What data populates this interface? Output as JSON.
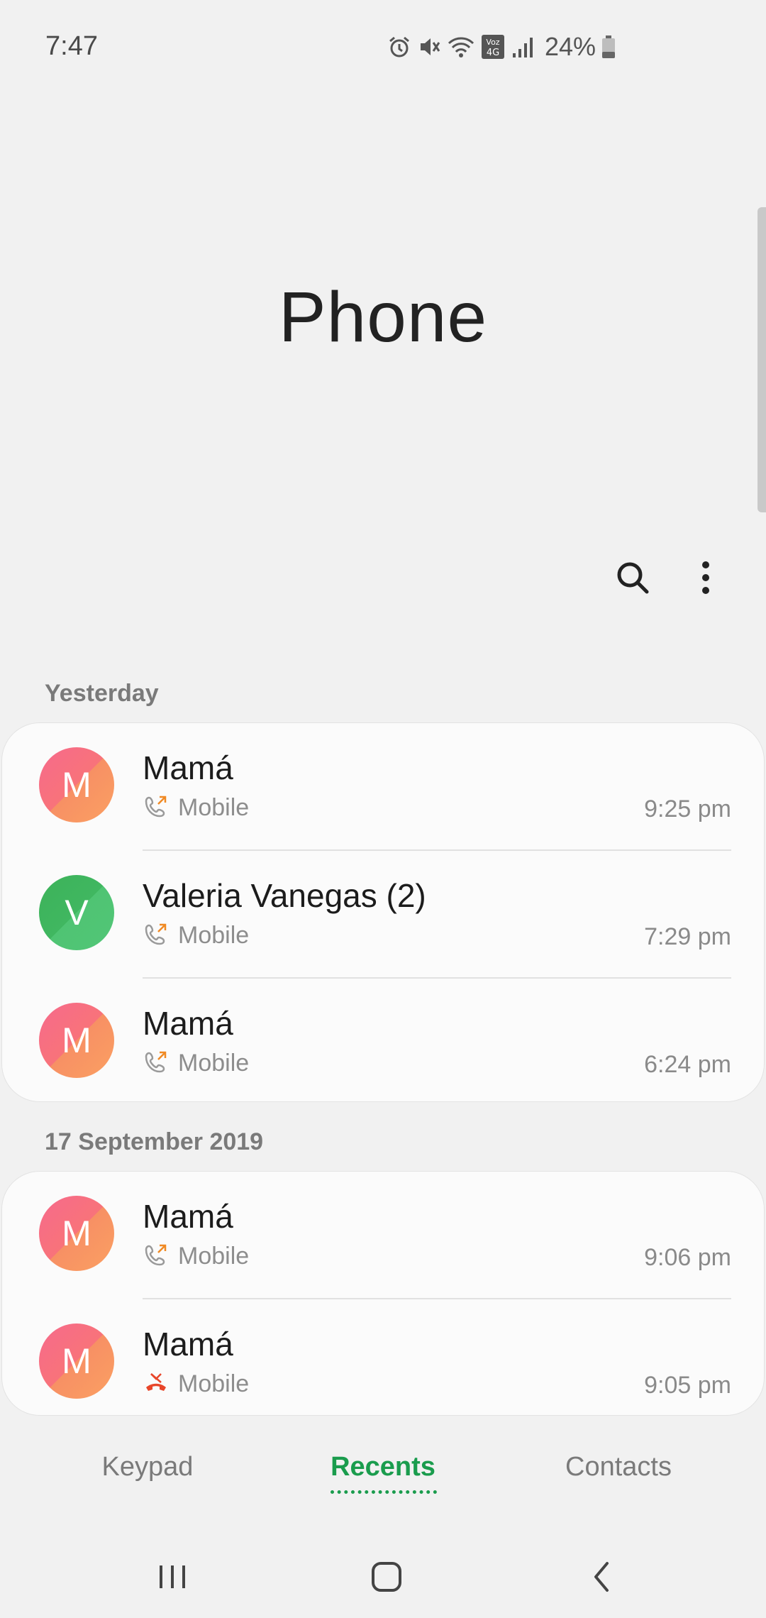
{
  "status_bar": {
    "time": "7:47",
    "battery": "24%",
    "icons": [
      "alarm-icon",
      "mute-icon",
      "wifi-icon",
      "volte-4g-icon",
      "signal-icon",
      "battery-icon"
    ]
  },
  "header": {
    "title": "Phone",
    "actions": [
      "search-icon",
      "more-options-icon"
    ]
  },
  "sections": [
    {
      "label": "Yesterday",
      "calls": [
        {
          "initial": "M",
          "name": "Mamá",
          "type": "Mobile",
          "time": "9:25 pm",
          "direction": "outgoing",
          "avatar_color": "pink"
        },
        {
          "initial": "V",
          "name": "Valeria Vanegas (2)",
          "type": "Mobile",
          "time": "7:29 pm",
          "direction": "outgoing",
          "avatar_color": "green"
        },
        {
          "initial": "M",
          "name": "Mamá",
          "type": "Mobile",
          "time": "6:24 pm",
          "direction": "outgoing",
          "avatar_color": "pink"
        }
      ]
    },
    {
      "label": "17 September 2019",
      "calls": [
        {
          "initial": "M",
          "name": "Mamá",
          "type": "Mobile",
          "time": "9:06 pm",
          "direction": "outgoing",
          "avatar_color": "pink"
        },
        {
          "initial": "M",
          "name": "Mamá",
          "type": "Mobile",
          "time": "9:05 pm",
          "direction": "rejected",
          "avatar_color": "pink"
        }
      ]
    }
  ],
  "tabs": {
    "keypad": "Keypad",
    "recents": "Recents",
    "contacts": "Contacts",
    "active": "Recents"
  },
  "colors": {
    "accent": "#1a9c4d",
    "outgoing_arrow": "#f08a24",
    "rejected": "#e8462a"
  }
}
